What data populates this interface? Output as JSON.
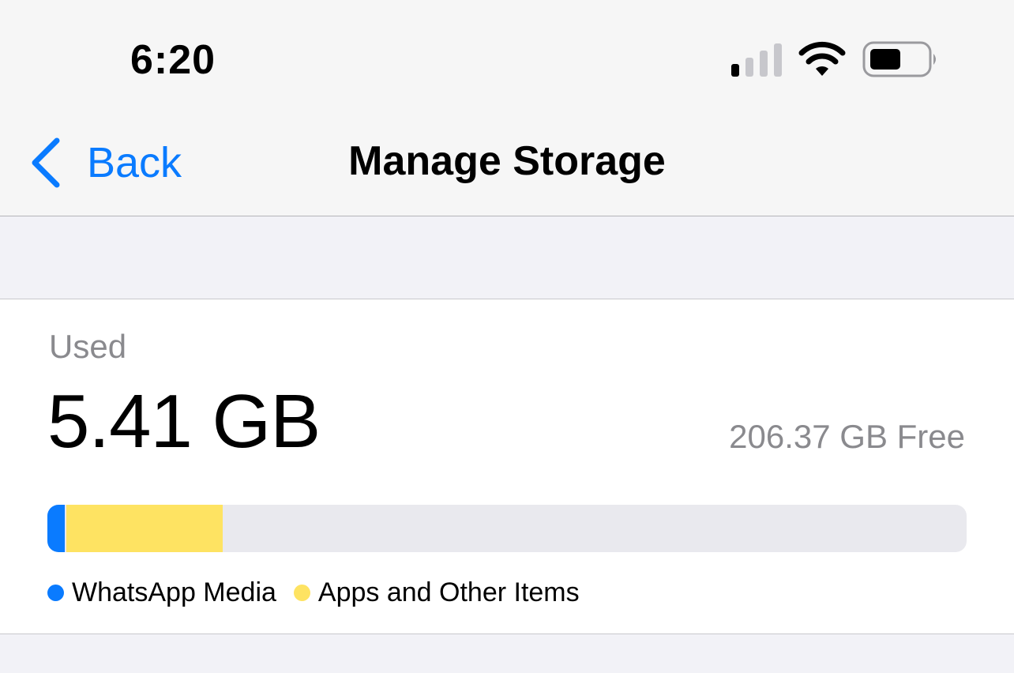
{
  "status_bar": {
    "time": "6:20",
    "icons": [
      "cellular-signal-icon",
      "wifi-icon",
      "battery-icon"
    ]
  },
  "nav": {
    "back_label": "Back",
    "back_icon": "chevron-left-icon",
    "title": "Manage Storage"
  },
  "storage": {
    "used_label": "Used",
    "used_value": "5.41 GB",
    "free_value": "206.37 GB Free",
    "bar_segments": [
      {
        "name": "WhatsApp Media",
        "fraction": 0.019,
        "color": "#0a7bff"
      },
      {
        "name": "Apps and Other Items",
        "fraction": 0.17,
        "color": "#fee362"
      }
    ],
    "legend": [
      {
        "label": "WhatsApp Media",
        "color": "#0a7bff"
      },
      {
        "label": "Apps and Other Items",
        "color": "#fee362"
      }
    ]
  },
  "colors": {
    "accent": "#0a7bff",
    "secondary_text": "#8a8a8e",
    "bar_track": "#e9e9ee"
  }
}
